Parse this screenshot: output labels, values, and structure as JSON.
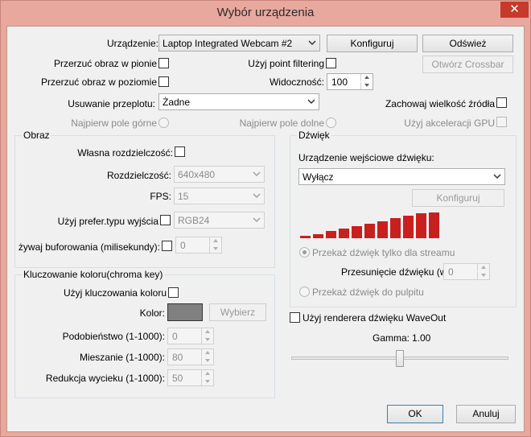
{
  "window": {
    "title": "Wybór urządzenia",
    "close_glyph": "✕"
  },
  "device": {
    "label": "Urządzenie:",
    "value": "Laptop Integrated Webcam #2",
    "configure": "Konfiguruj",
    "refresh": "Odśwież",
    "crossbar": "Otwórz Crossbar"
  },
  "flip_vertical": "Przerzuć obraz w pionie",
  "flip_horizontal": "Przerzuć obraz w poziomie",
  "point_filtering": "Użyj point filtering",
  "visibility": {
    "label": "Widoczność:",
    "value": "100"
  },
  "deinterlace": {
    "label": "Usuwanie przeplotu:",
    "value": "Żadne"
  },
  "keep_source_size": "Zachowaj wielkość źródła",
  "top_field_first": "Najpierw pole górne",
  "bottom_field_first": "Najpierw pole dolne",
  "gpu_accel": "Użyj akceleracji GPU",
  "image": {
    "title": "Obraz",
    "custom_res": "Własna rozdzielczość:",
    "res_label": "Rozdzielczość:",
    "res_value": "640x480",
    "fps_label": "FPS:",
    "fps_value": "15",
    "pref_type": "Użyj prefer.typu wyjścia",
    "pref_value": "RGB24",
    "buffering": "żywaj buforowania (milisekundy):",
    "buffering_value": "0"
  },
  "chroma": {
    "title": "Kluczowanie koloru(chroma key)",
    "use": "Użyj kluczowania koloru",
    "color_label": "Kolor:",
    "color_value": "#808080",
    "select": "Wybierz",
    "similarity_label": "Podobieństwo (1-1000):",
    "similarity_value": "0",
    "blend_label": "Mieszanie (1-1000):",
    "blend_value": "80",
    "spill_label": "Redukcja wycieku (1-1000):",
    "spill_value": "50"
  },
  "sound": {
    "title": "Dźwięk",
    "input_label": "Urządzenie wejściowe dźwięku:",
    "input_value": "Wyłącz",
    "configure": "Konfiguruj",
    "meter_levels": [
      0.1,
      0.17,
      0.27,
      0.37,
      0.47,
      0.57,
      0.67,
      0.77,
      0.87,
      0.97,
      1.0
    ],
    "meter_color": "#c8201f",
    "stream_only": "Przekaż dźwięk tylko dla streamu",
    "offset_label": "Przesunięcie dźwięku (w",
    "offset_value": "0",
    "to_desktop": "Przekaż dźwięk do pulpitu"
  },
  "waveout": "Użyj renderera dźwięku WaveOut",
  "gamma": {
    "label": "Gamma:",
    "value": "1.00",
    "level": 0.5
  },
  "ok": "OK",
  "cancel": "Anuluj"
}
